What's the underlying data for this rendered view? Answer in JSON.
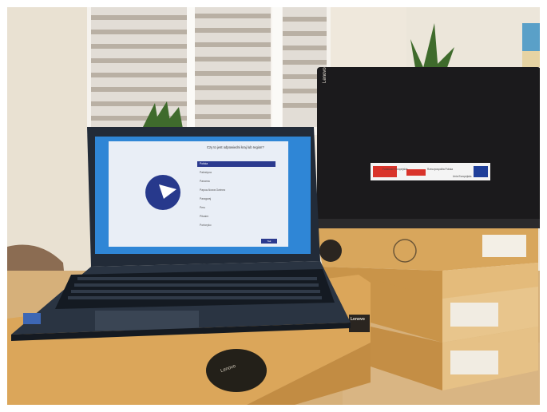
{
  "photo": {
    "description_hidden": null
  },
  "laptop_screen": {
    "title": "Czy to jest odpowiedni kraj lub region?",
    "options": [
      "Polska",
      "Palestyna",
      "Panama",
      "Papua-Nowa Gwinea",
      "Paragwaj",
      "Peru",
      "Pitcairn",
      "Portoryko"
    ],
    "selected_index": 0,
    "button_label": "Tak"
  },
  "laptop_brand": "Lenovo",
  "stacked_laptop_brand": "Lenovo",
  "box_brand": "Lenovo",
  "sticker": {
    "left": "Fundusze Europejskie",
    "middle": "Rzeczpospolita Polska",
    "right": "Unia Europejska"
  },
  "colors": {
    "screen_blue": "#2f86d6",
    "window_bg": "#e9eef6",
    "accent": "#2b3a8f",
    "cardboard": "#d9a960",
    "laptop_body": "#1d2633"
  }
}
